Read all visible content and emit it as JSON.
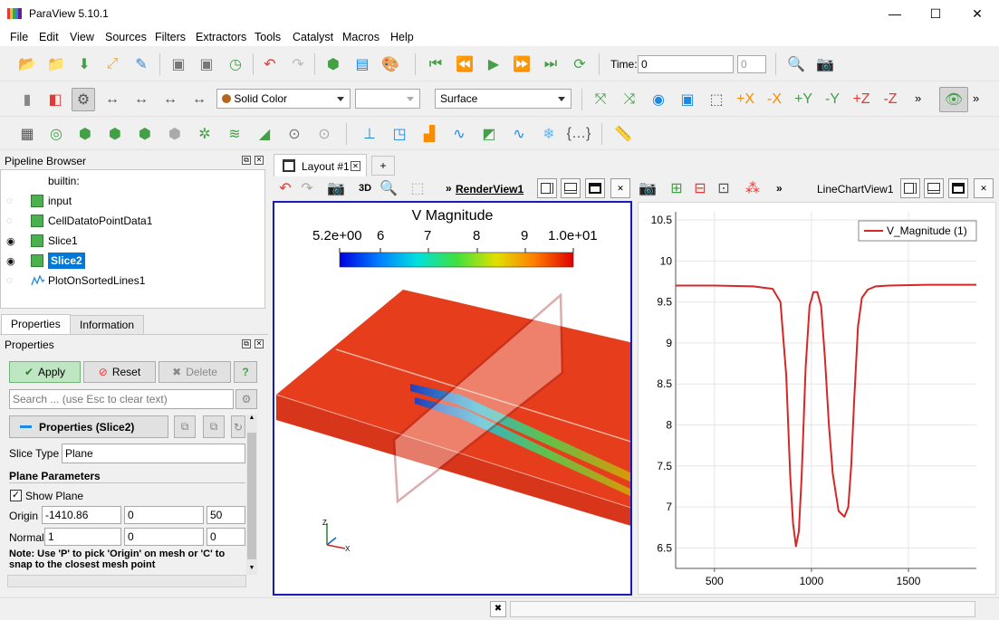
{
  "window": {
    "title": "ParaView 5.10.1",
    "minimize": "—",
    "maximize": "☐",
    "close": "✕"
  },
  "menu": [
    "File",
    "Edit",
    "View",
    "Sources",
    "Filters",
    "Extractors",
    "Tools",
    "Catalyst",
    "Macros",
    "Help"
  ],
  "toolbar1": {
    "time_label": "Time:",
    "time_value": "0",
    "timestep_value": "0"
  },
  "toolbar2": {
    "coloring": "Solid Color",
    "component": "",
    "representation": "Surface",
    "more": "»"
  },
  "pipeline": {
    "title": "Pipeline Browser",
    "items": [
      {
        "label": "builtin:",
        "eye": ""
      },
      {
        "label": "input",
        "eye": "◌"
      },
      {
        "label": "CellDatatoPointData1",
        "eye": "◌"
      },
      {
        "label": "Slice1",
        "eye": "◉"
      },
      {
        "label": "Slice2",
        "eye": "◉"
      },
      {
        "label": "PlotOnSortedLines1",
        "eye": "◌"
      }
    ]
  },
  "tabs": {
    "properties": "Properties",
    "information": "Information"
  },
  "properties": {
    "title": "Properties",
    "apply": "Apply",
    "reset": "Reset",
    "delete": "Delete",
    "help": "?",
    "search_placeholder": "Search ... (use Esc to clear text)",
    "section": "Properties (Slice2)",
    "slice_type_label": "Slice Type",
    "slice_type_value": "Plane",
    "plane_params": "Plane Parameters",
    "show_plane": "Show Plane",
    "origin_label": "Origin",
    "origin": [
      "-1410.86",
      "0",
      "50"
    ],
    "normal_label": "Normal",
    "normal": [
      "1",
      "0",
      "0"
    ],
    "note": "Note: Use 'P' to pick 'Origin' on mesh or 'C' to snap to the closest mesh point"
  },
  "layout": {
    "tab": "Layout #1",
    "add": "+"
  },
  "renderview": {
    "label": "RenderView1",
    "threed": "3D",
    "colorbar_title": "V Magnitude",
    "colorbar_ticks": [
      "5.2e+00",
      "6",
      "7",
      "8",
      "9",
      "1.0e+01"
    ]
  },
  "chartview": {
    "label": "LineChartView1"
  },
  "chart_data": {
    "type": "line",
    "title": "",
    "xlabel": "",
    "ylabel": "",
    "xlim": [
      300,
      1850
    ],
    "ylim": [
      6.25,
      10.6
    ],
    "xticks": [
      500,
      1000,
      1500
    ],
    "yticks": [
      6.5,
      7,
      7.5,
      8,
      8.5,
      9,
      9.5,
      10,
      10.5
    ],
    "legend": "top-right",
    "series": [
      {
        "name": "V_Magnitude (1)",
        "color": "#d62728",
        "x": [
          300,
          500,
          700,
          800,
          840,
          870,
          890,
          905,
          920,
          935,
          950,
          970,
          990,
          1010,
          1030,
          1050,
          1070,
          1090,
          1110,
          1140,
          1170,
          1190,
          1205,
          1220,
          1240,
          1260,
          1290,
          1330,
          1400,
          1600,
          1850
        ],
        "y": [
          9.7,
          9.7,
          9.69,
          9.66,
          9.5,
          8.6,
          7.4,
          6.8,
          6.52,
          6.7,
          7.4,
          8.7,
          9.45,
          9.62,
          9.62,
          9.45,
          8.8,
          8.0,
          7.4,
          6.95,
          6.88,
          7.0,
          7.5,
          8.3,
          9.2,
          9.55,
          9.65,
          9.69,
          9.7,
          9.71,
          9.71
        ]
      }
    ]
  }
}
